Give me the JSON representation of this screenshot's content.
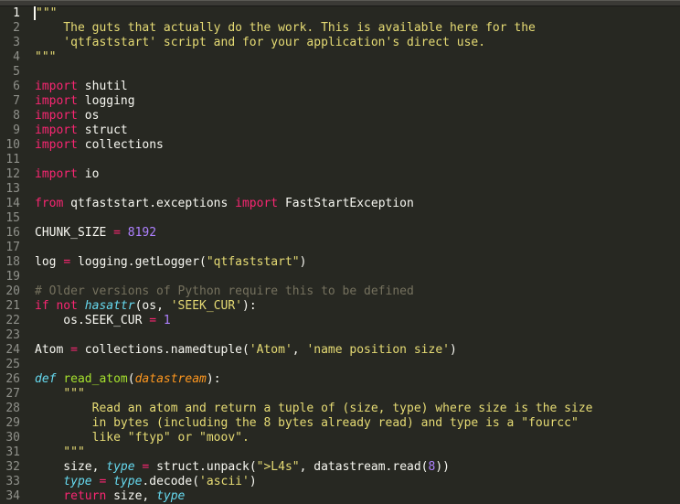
{
  "editor": {
    "current_line": 1,
    "lines": [
      {
        "n": 1,
        "tokens": [
          [
            "str",
            "\"\"\""
          ]
        ],
        "cursor_before": true
      },
      {
        "n": 2,
        "tokens": [
          [
            "str",
            "    The guts that actually do the work. This is available here for the"
          ]
        ]
      },
      {
        "n": 3,
        "tokens": [
          [
            "str",
            "    'qtfaststart' script and for your application's direct use."
          ]
        ]
      },
      {
        "n": 4,
        "tokens": [
          [
            "str",
            "\"\"\""
          ]
        ]
      },
      {
        "n": 5,
        "tokens": []
      },
      {
        "n": 6,
        "tokens": [
          [
            "kw",
            "import"
          ],
          [
            "plain",
            " shutil"
          ]
        ]
      },
      {
        "n": 7,
        "tokens": [
          [
            "kw",
            "import"
          ],
          [
            "plain",
            " logging"
          ]
        ]
      },
      {
        "n": 8,
        "tokens": [
          [
            "kw",
            "import"
          ],
          [
            "plain",
            " os"
          ]
        ]
      },
      {
        "n": 9,
        "tokens": [
          [
            "kw",
            "import"
          ],
          [
            "plain",
            " struct"
          ]
        ]
      },
      {
        "n": 10,
        "tokens": [
          [
            "kw",
            "import"
          ],
          [
            "plain",
            " collections"
          ]
        ]
      },
      {
        "n": 11,
        "tokens": []
      },
      {
        "n": 12,
        "tokens": [
          [
            "kw",
            "import"
          ],
          [
            "plain",
            " io"
          ]
        ]
      },
      {
        "n": 13,
        "tokens": []
      },
      {
        "n": 14,
        "tokens": [
          [
            "kw",
            "from"
          ],
          [
            "plain",
            " qtfaststart.exceptions "
          ],
          [
            "kw",
            "import"
          ],
          [
            "plain",
            " FastStartException"
          ]
        ]
      },
      {
        "n": 15,
        "tokens": []
      },
      {
        "n": 16,
        "tokens": [
          [
            "plain",
            "CHUNK_SIZE "
          ],
          [
            "kw",
            "="
          ],
          [
            "plain",
            " "
          ],
          [
            "num",
            "8192"
          ]
        ]
      },
      {
        "n": 17,
        "tokens": []
      },
      {
        "n": 18,
        "tokens": [
          [
            "plain",
            "log "
          ],
          [
            "kw",
            "="
          ],
          [
            "plain",
            " logging.getLogger("
          ],
          [
            "str",
            "\"qtfaststart\""
          ],
          [
            "plain",
            ")"
          ]
        ]
      },
      {
        "n": 19,
        "tokens": []
      },
      {
        "n": 20,
        "tokens": [
          [
            "cmt",
            "# Older versions of Python require this to be defined"
          ]
        ]
      },
      {
        "n": 21,
        "tokens": [
          [
            "kw",
            "if"
          ],
          [
            "plain",
            " "
          ],
          [
            "kw",
            "not"
          ],
          [
            "plain",
            " "
          ],
          [
            "type",
            "hasattr"
          ],
          [
            "plain",
            "(os, "
          ],
          [
            "str",
            "'SEEK_CUR'"
          ],
          [
            "plain",
            "):"
          ]
        ]
      },
      {
        "n": 22,
        "tokens": [
          [
            "plain",
            "    os.SEEK_CUR "
          ],
          [
            "kw",
            "="
          ],
          [
            "plain",
            " "
          ],
          [
            "num",
            "1"
          ]
        ]
      },
      {
        "n": 23,
        "tokens": []
      },
      {
        "n": 24,
        "tokens": [
          [
            "plain",
            "Atom "
          ],
          [
            "kw",
            "="
          ],
          [
            "plain",
            " collections.namedtuple("
          ],
          [
            "str",
            "'Atom'"
          ],
          [
            "plain",
            ", "
          ],
          [
            "str",
            "'name position size'"
          ],
          [
            "plain",
            ")"
          ]
        ]
      },
      {
        "n": 25,
        "tokens": []
      },
      {
        "n": 26,
        "tokens": [
          [
            "type",
            "def"
          ],
          [
            "plain",
            " "
          ],
          [
            "fn",
            "read_atom"
          ],
          [
            "plain",
            "("
          ],
          [
            "arg",
            "datastream"
          ],
          [
            "plain",
            "):"
          ]
        ]
      },
      {
        "n": 27,
        "tokens": [
          [
            "plain",
            "    "
          ],
          [
            "str",
            "\"\"\""
          ]
        ]
      },
      {
        "n": 28,
        "tokens": [
          [
            "str",
            "        Read an atom and return a tuple of (size, type) where size is the size"
          ]
        ]
      },
      {
        "n": 29,
        "tokens": [
          [
            "str",
            "        in bytes (including the 8 bytes already read) and type is a \"fourcc\""
          ]
        ]
      },
      {
        "n": 30,
        "tokens": [
          [
            "str",
            "        like \"ftyp\" or \"moov\"."
          ]
        ]
      },
      {
        "n": 31,
        "tokens": [
          [
            "str",
            "    \"\"\""
          ]
        ]
      },
      {
        "n": 32,
        "tokens": [
          [
            "plain",
            "    size, "
          ],
          [
            "type",
            "type"
          ],
          [
            "plain",
            " "
          ],
          [
            "kw",
            "="
          ],
          [
            "plain",
            " struct.unpack("
          ],
          [
            "str",
            "\">L4s\""
          ],
          [
            "plain",
            ", datastream.read("
          ],
          [
            "num",
            "8"
          ],
          [
            "plain",
            "))"
          ]
        ]
      },
      {
        "n": 33,
        "tokens": [
          [
            "plain",
            "    "
          ],
          [
            "type",
            "type"
          ],
          [
            "plain",
            " "
          ],
          [
            "kw",
            "="
          ],
          [
            "plain",
            " "
          ],
          [
            "type",
            "type"
          ],
          [
            "plain",
            ".decode("
          ],
          [
            "str",
            "'ascii'"
          ],
          [
            "plain",
            ")"
          ]
        ]
      },
      {
        "n": 34,
        "tokens": [
          [
            "plain",
            "    "
          ],
          [
            "kw",
            "return"
          ],
          [
            "plain",
            " size, "
          ],
          [
            "type",
            "type"
          ]
        ]
      }
    ]
  }
}
